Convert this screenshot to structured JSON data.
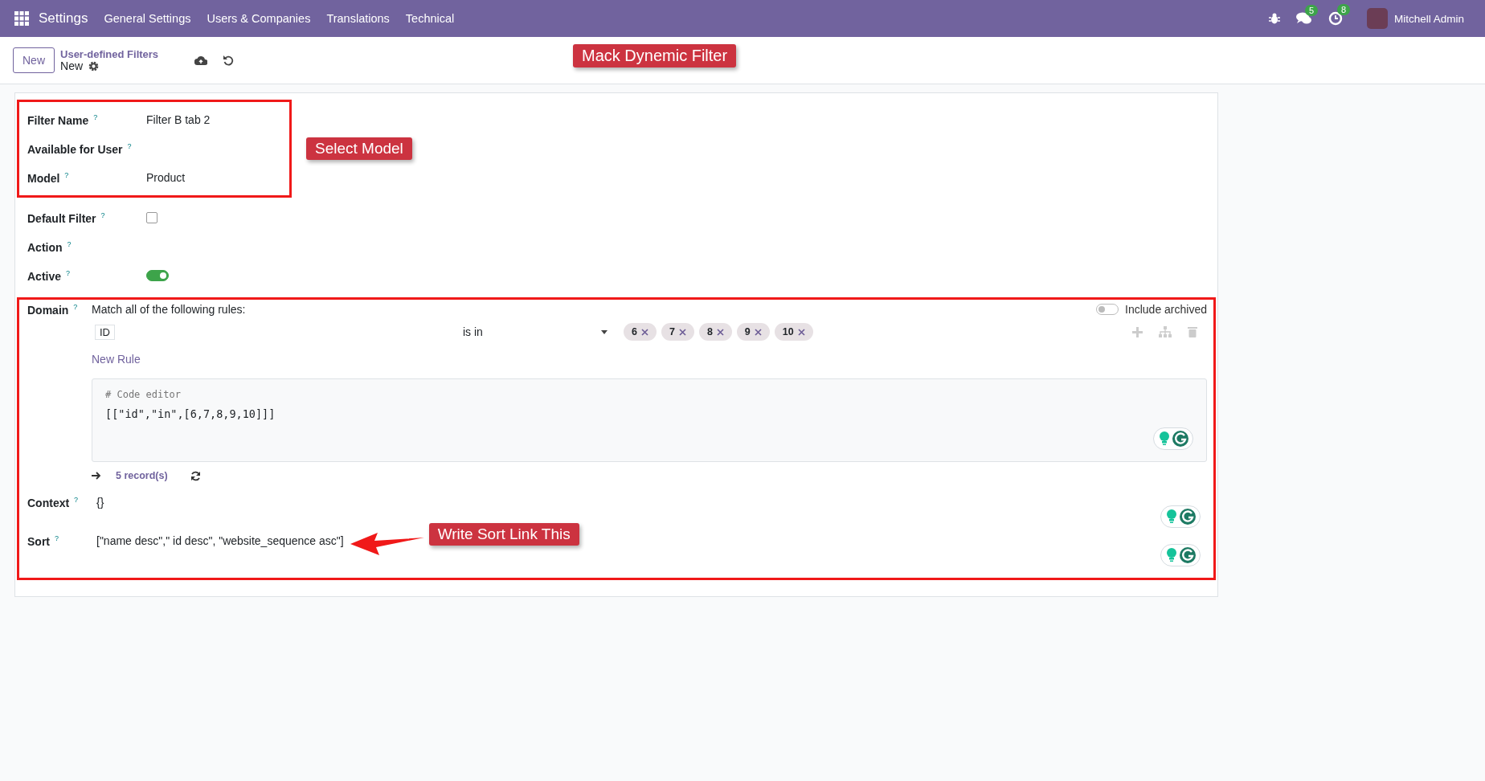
{
  "navbar": {
    "app": "Settings",
    "menus": [
      "General Settings",
      "Users & Companies",
      "Translations",
      "Technical"
    ],
    "messages_badge": "5",
    "activities_badge": "8",
    "user": "Mitchell Admin"
  },
  "control_panel": {
    "new_button": "New",
    "breadcrumb_parent": "User-defined Filters",
    "breadcrumb_current": "New",
    "callout": "Mack Dynemic Filter"
  },
  "form": {
    "groups": [
      {
        "highlighted": true,
        "callout": "Select Model",
        "fields": [
          {
            "kind": "text",
            "label": "Filter Name",
            "help": "?",
            "value": "Filter B tab 2"
          },
          {
            "kind": "text",
            "label": "Available for User",
            "help": "?"
          },
          {
            "kind": "text",
            "label": "Model",
            "help": "?",
            "value": "Product"
          }
        ]
      },
      {
        "highlighted": false,
        "fields": [
          {
            "kind": "checkbox",
            "label": "Default Filter",
            "help": "?",
            "checked": false
          },
          {
            "kind": "text",
            "label": "Action",
            "help": "?"
          },
          {
            "kind": "toggle",
            "label": "Active",
            "help": "?",
            "on": true
          }
        ]
      }
    ],
    "domain_section": {
      "highlighted": true,
      "domain": {
        "label": "Domain",
        "help": "?",
        "match_text": "Match all of the following rules:",
        "include_archived": {
          "label": "Include archived",
          "on": false
        },
        "rule": {
          "field": "ID",
          "operator": "is in",
          "values": [
            "6",
            "7",
            "8",
            "9",
            "10"
          ]
        },
        "new_rule": "New Rule",
        "code_comment": "# Code editor",
        "code": "[[\"id\",\"in\",[6,7,8,9,10]]]",
        "records": "5 record(s)"
      },
      "context": {
        "label": "Context",
        "help": "?",
        "value": "{}"
      },
      "sort": {
        "label": "Sort",
        "help": "?",
        "value": "[\"name desc\",\" id desc\", \"website_sequence asc\"]",
        "callout": "Write Sort Link This"
      }
    }
  }
}
